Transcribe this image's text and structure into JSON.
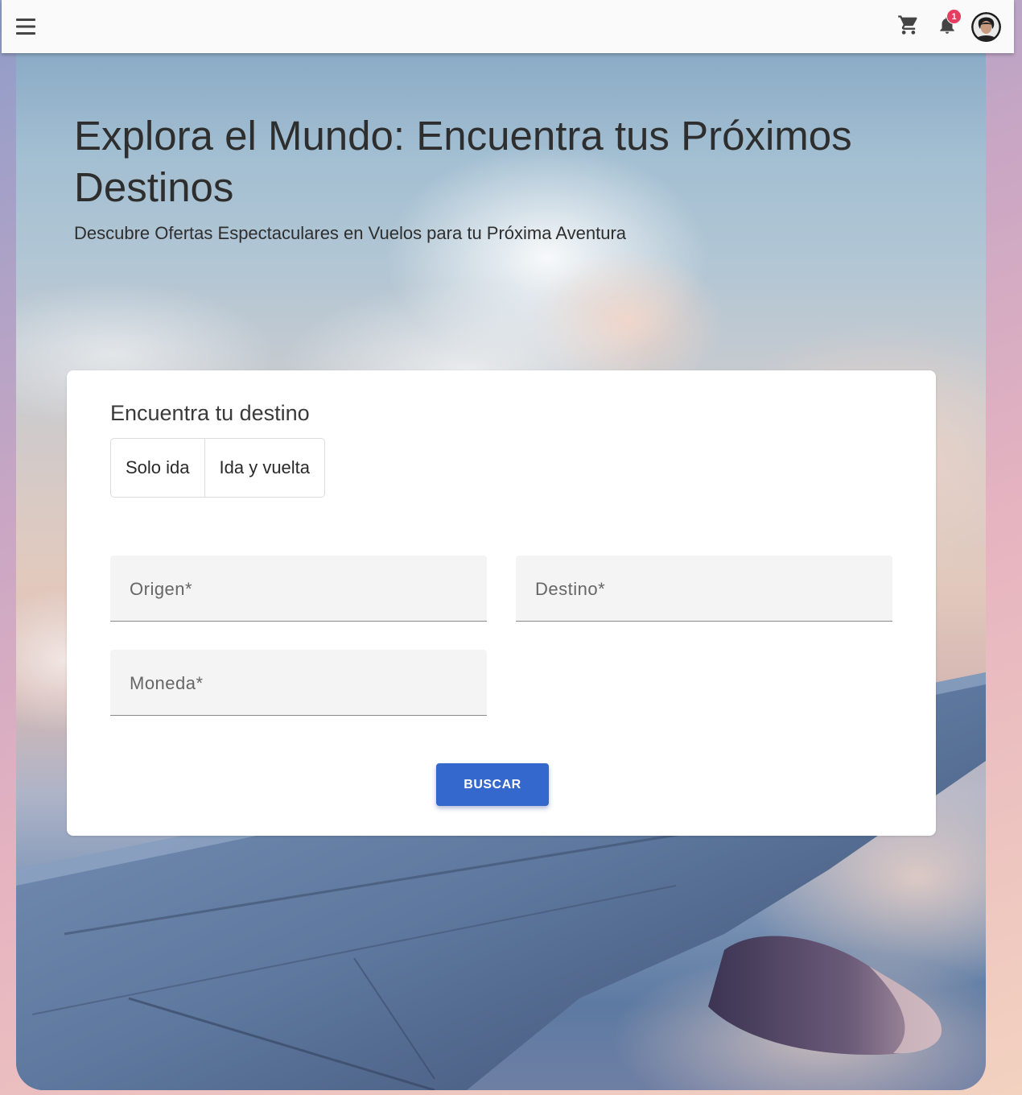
{
  "header": {
    "menu_icon": "menu-icon",
    "cart_icon": "cart-icon",
    "notifications_icon": "bell-icon",
    "notification_count": "1",
    "badge_color": "#e53c5f",
    "avatar_icon": "user-avatar"
  },
  "hero": {
    "title": "Explora el Mundo: Encuentra tus Próximos Destinos",
    "subtitle": "Descubre Ofertas Espectaculares en Vuelos para tu Próxima Aventura"
  },
  "search": {
    "title": "Encuentra tu destino",
    "trip_types": [
      "Solo ida",
      "Ida y vuelta"
    ],
    "origin_label": "Origen*",
    "destination_label": "Destino*",
    "currency_label": "Moneda*",
    "submit_label": "BUSCAR",
    "submit_color": "#3468cc"
  }
}
